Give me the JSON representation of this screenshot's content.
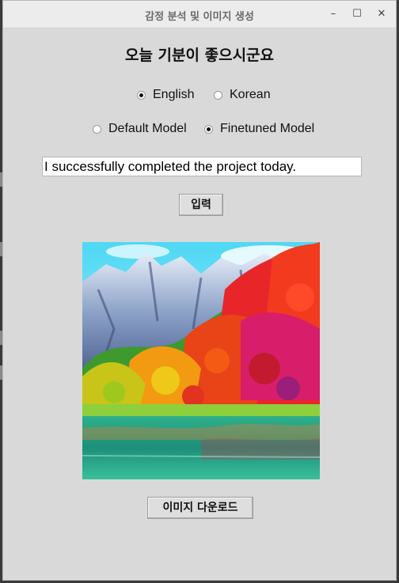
{
  "window": {
    "title": "감정 분석 및 이미지 생성",
    "controls": {
      "minimize": "–",
      "maximize": "☐",
      "close": "✕"
    }
  },
  "result": {
    "headline": "오늘 기분이 좋으시군요"
  },
  "language": {
    "options": [
      {
        "label": "English",
        "selected": true
      },
      {
        "label": "Korean",
        "selected": false
      }
    ]
  },
  "model": {
    "options": [
      {
        "label": "Default Model",
        "selected": false
      },
      {
        "label": "Finetuned Model",
        "selected": true
      }
    ]
  },
  "input": {
    "value": "I successfully completed the project today."
  },
  "buttons": {
    "submit": "입력",
    "download": "이미지 다운로드"
  },
  "image": {
    "subject": "colorful autumn forest with mountains and lake"
  }
}
